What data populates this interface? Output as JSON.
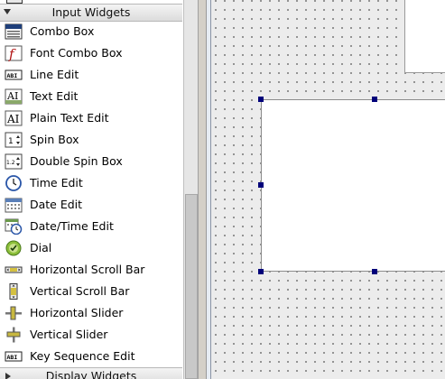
{
  "widget_box": {
    "input_category_label": "Input Widgets",
    "display_category_label": "Display Widgets",
    "items": [
      {
        "label": "Combo Box",
        "icon": "combo-box-icon"
      },
      {
        "label": "Font Combo Box",
        "icon": "font-combo-box-icon"
      },
      {
        "label": "Line Edit",
        "icon": "line-edit-icon"
      },
      {
        "label": "Text Edit",
        "icon": "text-edit-icon"
      },
      {
        "label": "Plain Text Edit",
        "icon": "plain-text-edit-icon"
      },
      {
        "label": "Spin Box",
        "icon": "spin-box-icon"
      },
      {
        "label": "Double Spin Box",
        "icon": "double-spin-box-icon"
      },
      {
        "label": "Time Edit",
        "icon": "clock-icon"
      },
      {
        "label": "Date Edit",
        "icon": "calendar-icon"
      },
      {
        "label": "Date/Time Edit",
        "icon": "calendar-clock-icon"
      },
      {
        "label": "Dial",
        "icon": "dial-icon"
      },
      {
        "label": "Horizontal Scroll Bar",
        "icon": "horizontal-scroll-bar-icon"
      },
      {
        "label": "Vertical Scroll Bar",
        "icon": "vertical-scroll-bar-icon"
      },
      {
        "label": "Horizontal Slider",
        "icon": "horizontal-slider-icon"
      },
      {
        "label": "Vertical Slider",
        "icon": "vertical-slider-icon"
      },
      {
        "label": "Key Sequence Edit",
        "icon": "key-sequence-edit-icon"
      }
    ],
    "icon_text": {
      "line_edit": "ABI",
      "text_edit": "AI",
      "spin_box": "1",
      "double_spin_box": "1.2",
      "key_sequence": "ABI",
      "font": "f"
    }
  },
  "colors": {
    "selection_handle": "#00007a",
    "canvas_background": "#ececec",
    "panel_background": "#ffffff"
  }
}
